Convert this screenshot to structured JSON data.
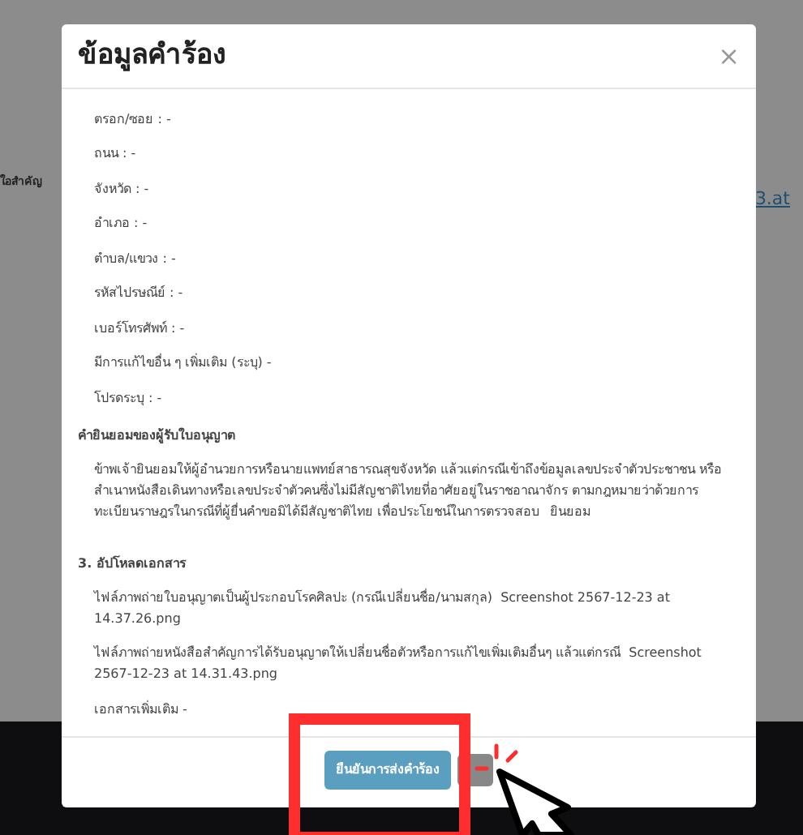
{
  "background": {
    "left_heading": "ใอสำคัญ",
    "right_link": "3.at"
  },
  "dialog": {
    "title": "ข้อมูลคำร้อง",
    "close": "×",
    "fields": [
      "ตรอก/ซอย : -",
      "ถนน : -",
      "จังหวัด : -",
      "อำเภอ : -",
      "ตำบล/แขวง : -",
      "รหัสไปรษณีย์ : -",
      "เบอร์โทรศัพท์ : -",
      "มีการแก้ไขอื่น ๆ เพิ่มเติม (ระบุ) -",
      "โปรดระบุ : -"
    ],
    "consent": {
      "heading": "คำยินยอมของผู้รับใบอนุญาต",
      "text": "ข้าพเจ้ายินยอมให้ผู้อำนวยการหรือนายแพทย์สาธารณสุขจังหวัด แล้วแต่กรณีเข้าถึงข้อมูลเลขประจำตัวประชาชน หรือ สำเนาหนังสือเดินทางหรือเลขประจำตัวคนซึ่งไม่มีสัญชาติไทยที่อาศัยอยู่ในราชอาณาจักร ตามกฎหมายว่าด้วยการทะเบียนราษฎรในกรณีที่ผู้ยื่นคำขอมิได้มีสัญชาติไทย เพื่อประโยชน์ในการตรวจสอบ",
      "answer": "ยินยอม"
    },
    "uploads": {
      "heading": "3. อัปโหลดเอกสาร",
      "files": [
        {
          "label": "ไฟล์ภาพถ่ายใบอนุญาตเป็นผู้ประกอบโรคศิลปะ (กรณีเปลี่ยนชื่อ/นามสกุล)",
          "file": "Screenshot 2567-12-23 at 14.37.26.png"
        },
        {
          "label": "ไฟล์ภาพถ่ายหนังสือสำคัญการได้รับอนุญาตให้เปลี่ยนชื่อตัวหรือการแก้ไขเพิ่มเติมอื่นๆ แล้วแต่กรณี",
          "file": "Screenshot 2567-12-23 at 14.31.43.png"
        }
      ],
      "extra": "เอกสารเพิ่มเติม -"
    },
    "confirm_button": "ยืนยันการส่งคำร้อง"
  }
}
